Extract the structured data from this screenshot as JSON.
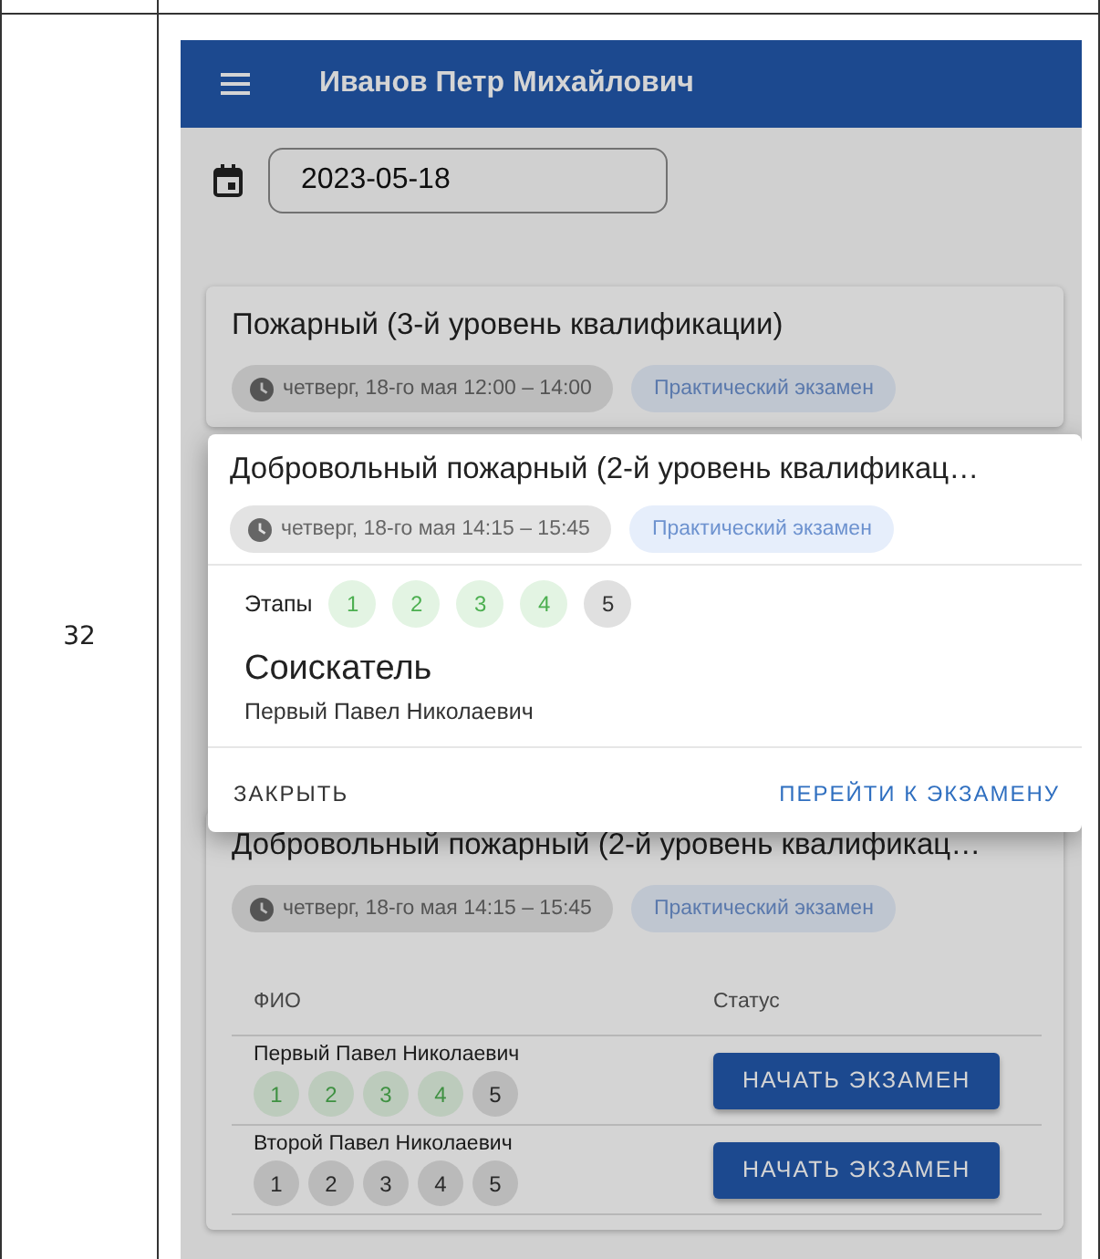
{
  "table": {
    "row_number": "32"
  },
  "app_bar": {
    "title": "Иванов Петр Михайлович"
  },
  "date_field": {
    "value": "2023-05-18"
  },
  "exams": [
    {
      "title": "Пожарный (3-й уровень квалификации)",
      "time": "четверг, 18-го мая 12:00 – 14:00",
      "type": "Практический экзамен"
    },
    {
      "title": "Добровольный пожарный (2-й уровень квалификац…",
      "time": "четверг, 18-го мая 14:15 – 15:45",
      "type": "Практический экзамен",
      "columns": [
        "ФИО",
        "Статус"
      ],
      "candidates": [
        {
          "name": "Первый Павел Николаевич",
          "action": "НАЧАТЬ ЭКЗАМЕН",
          "stages": [
            {
              "label": "1",
              "done": true
            },
            {
              "label": "2",
              "done": true
            },
            {
              "label": "3",
              "done": true
            },
            {
              "label": "4",
              "done": true
            },
            {
              "label": "5",
              "done": false
            }
          ]
        },
        {
          "name": "Второй Павел Николаевич",
          "action": "НАЧАТЬ ЭКЗАМЕН",
          "stages": [
            {
              "label": "1",
              "done": false
            },
            {
              "label": "2",
              "done": false
            },
            {
              "label": "3",
              "done": false
            },
            {
              "label": "4",
              "done": false
            },
            {
              "label": "5",
              "done": false
            }
          ]
        }
      ]
    }
  ],
  "dialog": {
    "title": "Добровольный пожарный (2-й уровень квалификац…",
    "time": "четверг, 18-го мая 14:15 – 15:45",
    "type": "Практический экзамен",
    "stages_label": "Этапы",
    "stages": [
      {
        "label": "1",
        "done": true
      },
      {
        "label": "2",
        "done": true
      },
      {
        "label": "3",
        "done": true
      },
      {
        "label": "4",
        "done": true
      },
      {
        "label": "5",
        "done": false
      }
    ],
    "role": "Соискатель",
    "name": "Первый Павел Николаевич",
    "buttons": [
      {
        "label": "ЗАКРЫТЬ",
        "kind": "text"
      },
      {
        "label": "ПЕРЕЙТИ К ЭКЗАМЕНУ",
        "kind": "primary"
      }
    ]
  }
}
